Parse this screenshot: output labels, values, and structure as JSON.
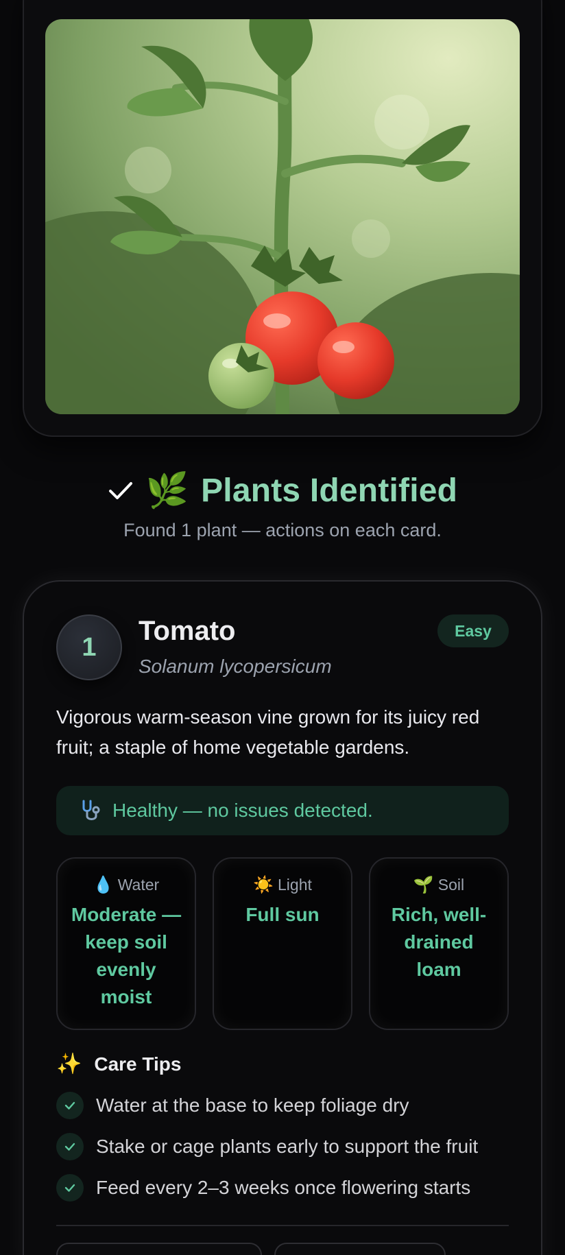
{
  "photo": {
    "subject": "tomato plant photo"
  },
  "result": {
    "title": "Plants Identified",
    "leaf_emoji": "🌿",
    "subtitle": "Found 1 plant — actions on each card."
  },
  "plant": {
    "index": "1",
    "name": "Tomato",
    "latin": "Solanum lycopersicum",
    "difficulty": "Easy",
    "description": "Vigorous warm-season vine grown for its juicy red fruit; a staple of home vegetable gardens.",
    "health": "Healthy — no issues detected.",
    "stats": [
      {
        "emoji": "💧",
        "label": "Water",
        "value": "Moderate — keep soil evenly moist"
      },
      {
        "emoji": "☀️",
        "label": "Light",
        "value": "Full sun"
      },
      {
        "emoji": "🌱",
        "label": "Soil",
        "value": "Rich, well-drained loam"
      }
    ],
    "tips_emoji": "✨",
    "tips_title": "Care Tips",
    "tips": [
      "Water at the base to keep foliage dry",
      "Stake or cage plants early to support the fruit",
      "Feed every 2–3 weeks once flowering starts"
    ]
  },
  "colors": {
    "accent": "#5fc9a0",
    "heading": "#8fd6b3",
    "background": "#09090b"
  }
}
